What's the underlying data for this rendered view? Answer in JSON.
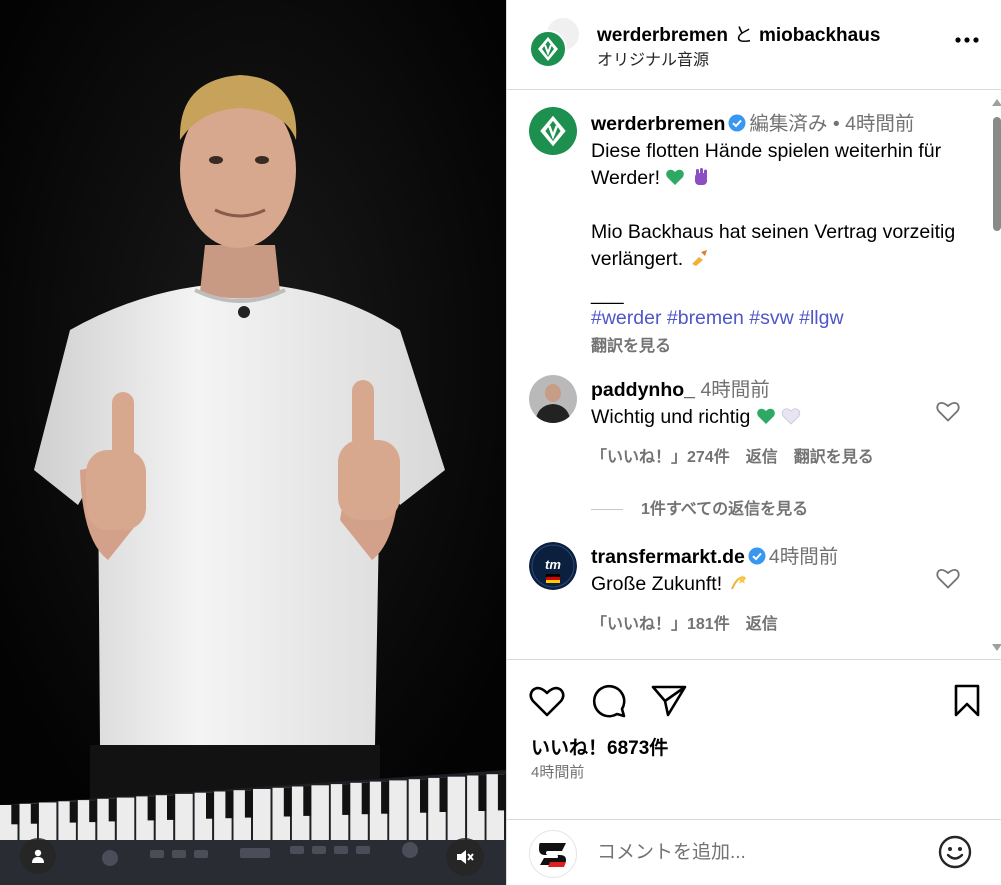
{
  "header": {
    "user_primary": "werderbremen",
    "conjunction": "と",
    "user_collab": "miobackhaus",
    "audio": "オリジナル音源"
  },
  "caption": {
    "username": "werderbremen",
    "edited": "編集済み",
    "dot": "•",
    "time": "4時間前",
    "line1": "Diese flotten Hände spielen weiterhin für Werder!",
    "line2": "Mio Backhaus hat seinen Vertrag vorzeitig verlängert.",
    "separator": "___",
    "hashtags": [
      "#werder",
      "#bremen",
      "#svw",
      "#llgw"
    ],
    "see_translation": "翻訳を見る"
  },
  "comments": [
    {
      "username": "paddynho_",
      "time": "4時間前",
      "text": "Wichtig und richtig",
      "likes": "「いいね！」274件",
      "reply": "返信",
      "translate": "翻訳を見る",
      "view_replies": "1件すべての返信を見る"
    },
    {
      "username": "transfermarkt.de",
      "time": "4時間前",
      "text": "Große Zukunft!",
      "likes": "「いいね！」181件",
      "reply": "返信"
    }
  ],
  "post": {
    "likes": "いいね！6873件",
    "time": "4時間前"
  },
  "comment_box": {
    "placeholder": "コメントを追加..."
  },
  "colors": {
    "werder_green": "#1d8f4f",
    "link_blue": "#4e56c8",
    "verified_blue": "#3897f0",
    "muted_gray": "#737373"
  }
}
